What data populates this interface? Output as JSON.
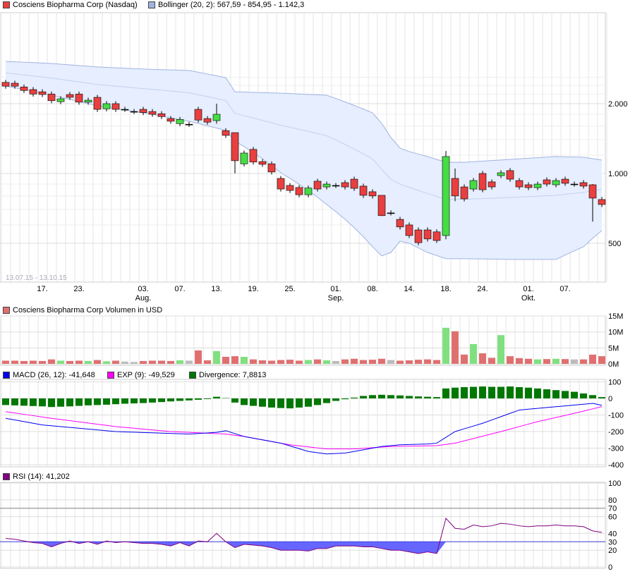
{
  "legends": {
    "price": "Cosciens Biopharma Corp (Nasdaq)",
    "bollinger": "Bollinger (20, 2): 567,59 - 854,95 - 1.142,3",
    "volume": "Cosciens Biopharma Corp Volumen in USD",
    "macd": "MACD (26, 12): -41,648",
    "exp": "EXP (9): -49,529",
    "divergence": "Divergence: 7,8813",
    "rsi": "RSI (14): 41,202",
    "range": "13.07.15 - 13.10.15"
  },
  "colors": {
    "up": "#44dd44",
    "down": "#e84040",
    "vol_up": "#80e080",
    "vol_down": "#e07070",
    "band_fill": "#e6eeff",
    "band_line": "#a0b4e0",
    "macd": "#0000ee",
    "exp": "#ff00ff",
    "div": "#007700",
    "rsi": "#800080",
    "rsi_fill": "#6666ff"
  },
  "chart_data": [
    {
      "type": "candlestick",
      "title": "Cosciens Biopharma Corp (Nasdaq)",
      "yscale": "log",
      "yticks": [
        {
          "v": 500,
          "label": "500"
        },
        {
          "v": 1000,
          "label": "1.000"
        },
        {
          "v": 2000,
          "label": "2.000"
        }
      ],
      "xticks": [
        {
          "i": 4,
          "label": "17."
        },
        {
          "i": 8,
          "label": "23."
        },
        {
          "i": 15,
          "label": "03.",
          "sub": "Aug."
        },
        {
          "i": 19,
          "label": "07."
        },
        {
          "i": 23,
          "label": "13."
        },
        {
          "i": 27,
          "label": "19."
        },
        {
          "i": 31,
          "label": "25."
        },
        {
          "i": 36,
          "label": "01.",
          "sub": "Sep."
        },
        {
          "i": 40,
          "label": "08."
        },
        {
          "i": 44,
          "label": "14."
        },
        {
          "i": 48,
          "label": "18."
        },
        {
          "i": 52,
          "label": "24."
        },
        {
          "i": 57,
          "label": "01.",
          "sub": "Okt."
        },
        {
          "i": 61,
          "label": "07."
        }
      ],
      "ohlc_oc": [
        [
          2470,
          2380
        ],
        [
          2450,
          2380
        ],
        [
          2360,
          2280
        ],
        [
          2300,
          2200
        ],
        [
          2250,
          2190
        ],
        [
          2200,
          2060
        ],
        [
          2040,
          2100
        ],
        [
          2190,
          2130
        ],
        [
          2200,
          2030
        ],
        [
          2030,
          2070
        ],
        [
          2130,
          1890
        ],
        [
          1900,
          2000
        ],
        [
          2000,
          1890
        ],
        [
          1890,
          1890
        ],
        [
          1850,
          1850
        ],
        [
          1890,
          1830
        ],
        [
          1850,
          1800
        ],
        [
          1810,
          1760
        ],
        [
          1725,
          1680
        ],
        [
          1640,
          1710
        ],
        [
          1630,
          1630
        ],
        [
          1890,
          1700
        ],
        [
          1725,
          1665
        ],
        [
          1690,
          1800
        ],
        [
          1530,
          1460
        ],
        [
          1500,
          1135
        ],
        [
          1100,
          1225
        ],
        [
          1270,
          1120
        ],
        [
          1125,
          1095
        ],
        [
          1100,
          1015
        ],
        [
          952,
          857
        ],
        [
          888,
          845
        ],
        [
          870,
          810
        ],
        [
          810,
          865
        ],
        [
          926,
          857
        ],
        [
          875,
          900
        ],
        [
          888,
          888
        ],
        [
          913,
          875
        ],
        [
          945,
          863
        ],
        [
          882,
          805
        ],
        [
          834,
          800
        ],
        [
          805,
          658
        ],
        [
          676,
          676
        ],
        [
          634,
          588
        ],
        [
          600,
          540
        ],
        [
          571,
          503
        ],
        [
          571,
          522
        ],
        [
          560,
          514
        ],
        [
          540,
          1183
        ],
        [
          952,
          800
        ],
        [
          875,
          777
        ],
        [
          857,
          932
        ],
        [
          1000,
          851
        ],
        [
          920,
          875
        ],
        [
          979,
          1007
        ],
        [
          1029,
          945
        ],
        [
          932,
          875
        ],
        [
          894,
          869
        ],
        [
          869,
          900
        ],
        [
          939,
          900
        ],
        [
          894,
          932
        ],
        [
          945,
          907
        ],
        [
          900,
          900
        ],
        [
          913,
          882
        ],
        [
          894,
          783
        ],
        [
          772,
          735
        ]
      ],
      "wick_overrides": {
        "23": [
          2000,
          1640
        ],
        "25": [
          1500,
          1000
        ],
        "48": [
          1250,
          520
        ],
        "49": [
          1050,
          760
        ],
        "64": [
          900,
          620
        ],
        "41": [
          805,
          655
        ]
      },
      "bollinger_upper": [
        [
          0,
          3045
        ],
        [
          5,
          2980
        ],
        [
          10,
          2880
        ],
        [
          15,
          2820
        ],
        [
          20,
          2780
        ],
        [
          24,
          2590
        ],
        [
          25,
          2250
        ],
        [
          30,
          2220
        ],
        [
          35,
          2175
        ],
        [
          40,
          1826
        ],
        [
          41,
          1644
        ],
        [
          42,
          1429
        ],
        [
          43,
          1287
        ],
        [
          44,
          1243
        ],
        [
          46,
          1183
        ],
        [
          48,
          1118
        ],
        [
          50,
          1118
        ],
        [
          55,
          1150
        ],
        [
          60,
          1183
        ],
        [
          63,
          1175
        ],
        [
          65,
          1142.3
        ]
      ],
      "bollinger_lower": [
        [
          0,
          2383
        ],
        [
          5,
          2175
        ],
        [
          10,
          1958
        ],
        [
          15,
          1826
        ],
        [
          20,
          1679
        ],
        [
          24,
          1533
        ],
        [
          25,
          1380
        ],
        [
          30,
          1007
        ],
        [
          35,
          735
        ],
        [
          40,
          483
        ],
        [
          41,
          441
        ],
        [
          42,
          456
        ],
        [
          43,
          511
        ],
        [
          44,
          500
        ],
        [
          46,
          456
        ],
        [
          48,
          429
        ],
        [
          50,
          429
        ],
        [
          55,
          426
        ],
        [
          60,
          426
        ],
        [
          63,
          483
        ],
        [
          65,
          567.59
        ]
      ]
    },
    {
      "type": "bar",
      "title": "Volumen in USD",
      "unit": "M",
      "yticks": [
        {
          "v": 0,
          "label": "0M"
        },
        {
          "v": 5,
          "label": "5M"
        },
        {
          "v": 10,
          "label": "10M"
        },
        {
          "v": 15,
          "label": "15M"
        }
      ],
      "values": [
        1,
        1,
        0.9,
        1,
        0.9,
        1.4,
        1,
        0.9,
        1,
        0.9,
        1.2,
        0.8,
        1,
        0.7,
        0.6,
        0.9,
        1,
        1,
        0.9,
        1.1,
        1,
        4.2,
        1.1,
        4,
        2.2,
        2.4,
        2.2,
        1.4,
        1.1,
        1,
        1.2,
        1.3,
        1,
        1.2,
        1.4,
        1.1,
        0.9,
        1.4,
        1.6,
        1.2,
        1.3,
        1.6,
        1.2,
        1,
        1.1,
        1.3,
        1.4,
        1.2,
        11.3,
        10.2,
        2.9,
        6.2,
        3.3,
        1.9,
        9,
        2.4,
        1.8,
        1.6,
        1.4,
        1.5,
        1.6,
        1.5,
        1.4,
        1.4,
        2.9,
        2.4
      ]
    },
    {
      "type": "line",
      "title": "MACD",
      "yticks": [
        100,
        0,
        -100,
        -200,
        -300,
        -400
      ],
      "macd": [
        [
          0,
          -120
        ],
        [
          4,
          -160
        ],
        [
          8,
          -180
        ],
        [
          12,
          -200
        ],
        [
          20,
          -215
        ],
        [
          23,
          -205
        ],
        [
          24,
          -195
        ],
        [
          26,
          -230
        ],
        [
          30,
          -270
        ],
        [
          33,
          -320
        ],
        [
          35,
          -335
        ],
        [
          37,
          -330
        ],
        [
          39,
          -310
        ],
        [
          41,
          -290
        ],
        [
          43,
          -280
        ],
        [
          46,
          -275
        ],
        [
          47,
          -270
        ],
        [
          49,
          -200
        ],
        [
          52,
          -150
        ],
        [
          54,
          -110
        ],
        [
          56,
          -70
        ],
        [
          59,
          -55
        ],
        [
          62,
          -40
        ],
        [
          64,
          -30
        ],
        [
          65,
          -41.6
        ]
      ],
      "exp": [
        [
          0,
          -80
        ],
        [
          5,
          -120
        ],
        [
          12,
          -170
        ],
        [
          18,
          -200
        ],
        [
          24,
          -215
        ],
        [
          26,
          -230
        ],
        [
          31,
          -280
        ],
        [
          35,
          -305
        ],
        [
          38,
          -305
        ],
        [
          42,
          -290
        ],
        [
          47,
          -285
        ],
        [
          49,
          -270
        ],
        [
          54,
          -200
        ],
        [
          58,
          -140
        ],
        [
          62,
          -90
        ],
        [
          65,
          -49.5
        ]
      ],
      "divergence": [
        -40,
        -42,
        -44,
        -46,
        -48,
        -52,
        -50,
        -48,
        -45,
        -42,
        -40,
        -38,
        -35,
        -32,
        -30,
        -28,
        -25,
        -22,
        -18,
        -15,
        -12,
        -8,
        -4,
        10,
        2,
        -25,
        -40,
        -45,
        -50,
        -55,
        -58,
        -60,
        -55,
        -50,
        -40,
        -28,
        -15,
        -5,
        5,
        15,
        20,
        22,
        20,
        18,
        15,
        12,
        10,
        8,
        60,
        65,
        68,
        70,
        72,
        70,
        70,
        72,
        68,
        65,
        60,
        55,
        50,
        45,
        40,
        30,
        20,
        7.9
      ]
    },
    {
      "type": "line",
      "title": "RSI (14)",
      "yticks": [
        0,
        20,
        30,
        40,
        60,
        70,
        80,
        100
      ],
      "levels": [
        30,
        70
      ],
      "values": [
        34,
        33,
        31,
        29,
        28,
        24,
        28,
        31,
        28,
        30,
        27,
        31,
        29,
        30,
        29,
        28,
        28,
        27,
        25,
        29,
        25,
        31,
        30,
        40,
        30,
        23,
        27,
        26,
        25,
        23,
        20,
        20,
        20,
        19,
        22,
        22,
        25,
        25,
        25,
        24,
        24,
        22,
        20,
        20,
        18,
        16,
        18,
        16,
        58,
        46,
        45,
        50,
        48,
        49,
        52,
        51,
        49,
        48,
        49,
        49,
        50,
        49,
        49,
        48,
        43,
        41.2
      ]
    }
  ]
}
